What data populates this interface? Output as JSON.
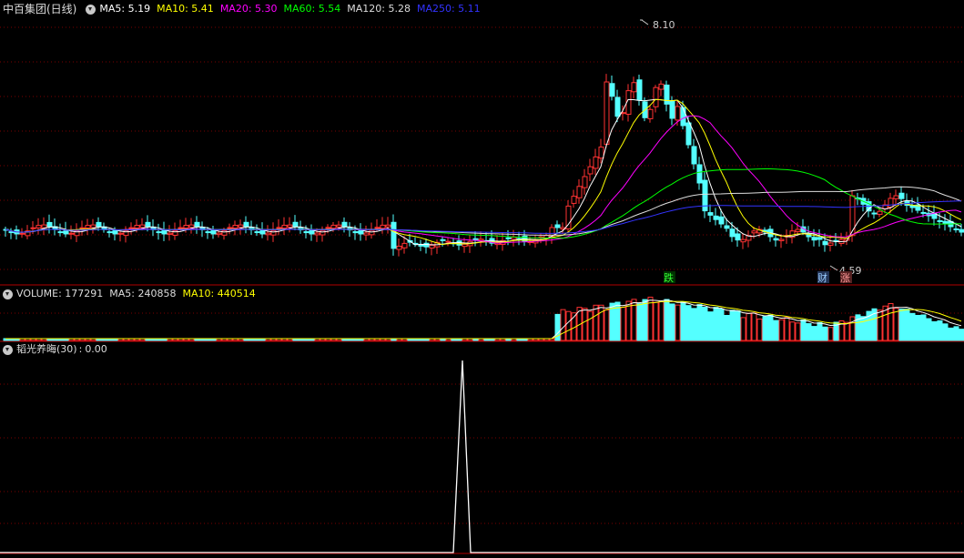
{
  "main": {
    "title": "中百集团(日线)",
    "ma": [
      {
        "label": "MA5: 5.19",
        "color": "#ffffff"
      },
      {
        "label": "MA10: 5.41",
        "color": "#ffff00"
      },
      {
        "label": "MA20: 5.30",
        "color": "#ff00ff"
      },
      {
        "label": "MA60: 5.54",
        "color": "#00ff00"
      },
      {
        "label": "MA120: 5.28",
        "color": "#dddddd"
      },
      {
        "label": "MA250: 5.11",
        "color": "#3333ff"
      }
    ],
    "high_label": "8.10",
    "low_label": "4.59",
    "markers": {
      "die": "跌",
      "cai": "财",
      "zhang": "涨"
    }
  },
  "volume": {
    "prefix": "VOLUME: 177291",
    "ma5": "MA5: 240858",
    "ma10": "MA10: 440514"
  },
  "indicator": {
    "label": "韬光养晦(30)",
    "value": "0.00"
  },
  "colors": {
    "up": "#ff3232",
    "down": "#54ffff",
    "grid": "#8b0000",
    "border": "#b00000"
  }
}
